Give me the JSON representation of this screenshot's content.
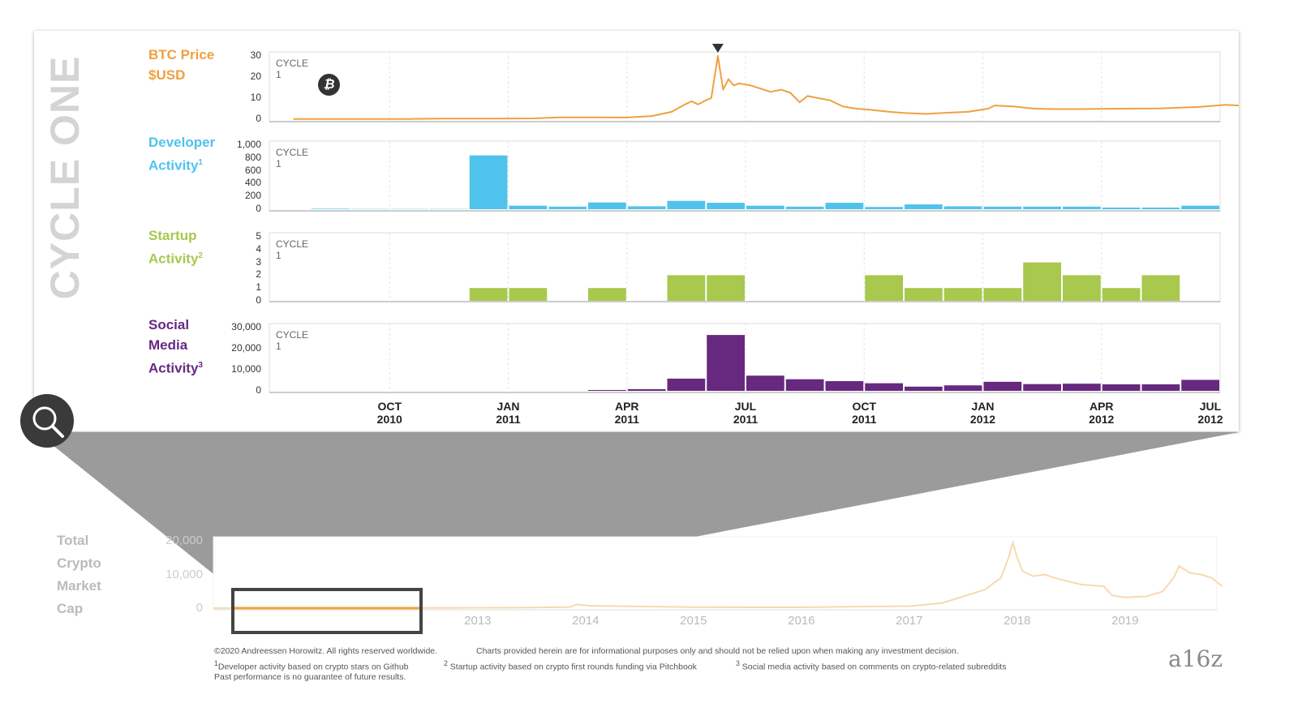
{
  "side_title": "CYCLE ONE",
  "panel_label": "CYCLE 1",
  "colors": {
    "btc": "#F0A040",
    "developer": "#4FC3EC",
    "startup": "#A8C84E",
    "social": "#66297F",
    "grey": "#999999"
  },
  "chart_data": [
    {
      "type": "line",
      "title": "BTC Price $USD",
      "title_lines": [
        "BTC Price",
        "$USD"
      ],
      "yticks": [
        "30",
        "20",
        "10",
        "0"
      ],
      "ylim": [
        0,
        30
      ],
      "icon": "bitcoin-icon",
      "annotation": "peak-marker-triangle",
      "points": [
        [
          "2010-07-18",
          0.07
        ],
        [
          "2010-09-01",
          0.06
        ],
        [
          "2010-10-15",
          0.1
        ],
        [
          "2010-11-10",
          0.3
        ],
        [
          "2010-12-15",
          0.25
        ],
        [
          "2011-01-20",
          0.4
        ],
        [
          "2011-02-10",
          0.9
        ],
        [
          "2011-03-10",
          0.85
        ],
        [
          "2011-04-01",
          0.8
        ],
        [
          "2011-04-20",
          1.5
        ],
        [
          "2011-05-05",
          3.5
        ],
        [
          "2011-05-15",
          7
        ],
        [
          "2011-05-20",
          8.5
        ],
        [
          "2011-05-25",
          7
        ],
        [
          "2011-06-01",
          9
        ],
        [
          "2011-06-05",
          10
        ],
        [
          "2011-06-07",
          18
        ],
        [
          "2011-06-10",
          30
        ],
        [
          "2011-06-12",
          22
        ],
        [
          "2011-06-14",
          14
        ],
        [
          "2011-06-18",
          19
        ],
        [
          "2011-06-22",
          16
        ],
        [
          "2011-06-26",
          17
        ],
        [
          "2011-07-05",
          16
        ],
        [
          "2011-07-20",
          13
        ],
        [
          "2011-07-28",
          14
        ],
        [
          "2011-08-05",
          12.5
        ],
        [
          "2011-08-12",
          8
        ],
        [
          "2011-08-18",
          11
        ],
        [
          "2011-08-26",
          10
        ],
        [
          "2011-09-05",
          9
        ],
        [
          "2011-09-15",
          6
        ],
        [
          "2011-09-25",
          5
        ],
        [
          "2011-10-05",
          4.5
        ],
        [
          "2011-10-20",
          3.5
        ],
        [
          "2011-11-01",
          3
        ],
        [
          "2011-11-18",
          2.5
        ],
        [
          "2011-12-01",
          3
        ],
        [
          "2011-12-20",
          3.5
        ],
        [
          "2012-01-05",
          5
        ],
        [
          "2012-01-10",
          6.5
        ],
        [
          "2012-01-25",
          6
        ],
        [
          "2012-02-10",
          5
        ],
        [
          "2012-02-25",
          4.8
        ],
        [
          "2012-03-15",
          4.8
        ],
        [
          "2012-04-15",
          5
        ],
        [
          "2012-05-15",
          5.1
        ],
        [
          "2012-06-15",
          5.8
        ],
        [
          "2012-07-05",
          6.8
        ],
        [
          "2012-07-15",
          6.5
        ]
      ]
    },
    {
      "type": "bar",
      "title": "Developer Activity",
      "title_lines": [
        "Developer",
        "Activity"
      ],
      "footnote_mark": "1",
      "yticks": [
        "1,000",
        "800",
        "600",
        "400",
        "200",
        "0"
      ],
      "ylim": [
        0,
        1000
      ],
      "categories": [
        "2010-08",
        "2010-09",
        "2010-10",
        "2010-11",
        "2010-12",
        "2011-01",
        "2011-02",
        "2011-03",
        "2011-04",
        "2011-05",
        "2011-06",
        "2011-07",
        "2011-08",
        "2011-09",
        "2011-10",
        "2011-11",
        "2011-12",
        "2012-01",
        "2012-02",
        "2012-03",
        "2012-04",
        "2012-05",
        "2012-06"
      ],
      "values": [
        8,
        4,
        4,
        4,
        840,
        55,
        40,
        105,
        45,
        130,
        100,
        55,
        40,
        100,
        35,
        75,
        45,
        40,
        40,
        40,
        25,
        25,
        55
      ]
    },
    {
      "type": "bar",
      "title": "Startup Activity",
      "title_lines": [
        "Startup",
        "Activity"
      ],
      "footnote_mark": "2",
      "yticks": [
        "5",
        "4",
        "3",
        "2",
        "1",
        "0"
      ],
      "ylim": [
        0,
        5
      ],
      "categories": [
        "2010-12",
        "2011-01",
        "2011-03",
        "2011-05",
        "2011-06",
        "2011-10",
        "2011-11",
        "2011-12",
        "2012-01",
        "2012-02",
        "2012-03",
        "2012-04",
        "2012-05"
      ],
      "values": [
        1,
        1,
        1,
        2,
        2,
        2,
        1,
        1,
        1,
        3,
        2,
        1,
        2
      ]
    },
    {
      "type": "bar",
      "title": "Social Media Activity",
      "title_lines": [
        "Social",
        "Media",
        "Activity"
      ],
      "footnote_mark": "3",
      "yticks": [
        "30,000",
        "20,000",
        "10,000",
        "0"
      ],
      "ylim": [
        0,
        30000
      ],
      "categories": [
        "2011-03",
        "2011-04",
        "2011-05",
        "2011-06",
        "2011-07",
        "2011-08",
        "2011-09",
        "2011-10",
        "2011-11",
        "2011-12",
        "2012-01",
        "2012-02",
        "2012-03",
        "2012-04",
        "2012-05",
        "2012-06"
      ],
      "values": [
        400,
        800,
        5800,
        26500,
        7200,
        5500,
        4600,
        3600,
        2000,
        2600,
        4300,
        3200,
        3400,
        3100,
        3100,
        5200
      ]
    },
    {
      "type": "line",
      "title": "Total Crypto Market Cap",
      "title_lines": [
        "Total",
        "Crypto",
        "Market",
        "Cap"
      ],
      "yticks": [
        "20,000",
        "10,000",
        "0"
      ],
      "ylim": [
        0,
        20000
      ],
      "xticks": [
        "2013",
        "2014",
        "2015",
        "2016",
        "2017",
        "2018",
        "2019"
      ],
      "highlight_range": [
        "2010-07",
        "2012-07"
      ],
      "points": [
        [
          2010.55,
          0
        ],
        [
          2012.5,
          40
        ],
        [
          2013.3,
          150
        ],
        [
          2013.85,
          300
        ],
        [
          2013.92,
          1100
        ],
        [
          2014.05,
          700
        ],
        [
          2014.5,
          500
        ],
        [
          2015,
          300
        ],
        [
          2015.5,
          250
        ],
        [
          2016,
          250
        ],
        [
          2016.5,
          450
        ],
        [
          2017,
          600
        ],
        [
          2017.3,
          1500
        ],
        [
          2017.5,
          3500
        ],
        [
          2017.7,
          5500
        ],
        [
          2017.85,
          9000
        ],
        [
          2017.92,
          15000
        ],
        [
          2017.96,
          19500
        ],
        [
          2018.0,
          15000
        ],
        [
          2018.05,
          11000
        ],
        [
          2018.15,
          9500
        ],
        [
          2018.25,
          10000
        ],
        [
          2018.4,
          8500
        ],
        [
          2018.6,
          7000
        ],
        [
          2018.8,
          6500
        ],
        [
          2018.88,
          3800
        ],
        [
          2019.0,
          3200
        ],
        [
          2019.2,
          3500
        ],
        [
          2019.35,
          5000
        ],
        [
          2019.45,
          9000
        ],
        [
          2019.5,
          12500
        ],
        [
          2019.6,
          10500
        ],
        [
          2019.7,
          10000
        ],
        [
          2019.8,
          9000
        ],
        [
          2019.9,
          6500
        ]
      ]
    }
  ],
  "xaxis_labels": [
    {
      "month": "OCT",
      "year": "2010",
      "date": "2010-10"
    },
    {
      "month": "JAN",
      "year": "2011",
      "date": "2011-01"
    },
    {
      "month": "APR",
      "year": "2011",
      "date": "2011-04"
    },
    {
      "month": "JUL",
      "year": "2011",
      "date": "2011-07"
    },
    {
      "month": "OCT",
      "year": "2011",
      "date": "2011-10"
    },
    {
      "month": "JAN",
      "year": "2012",
      "date": "2012-01"
    },
    {
      "month": "APR",
      "year": "2012",
      "date": "2012-04"
    },
    {
      "month": "JUL",
      "year": "2012",
      "date": "2012-07"
    }
  ],
  "footer": {
    "copyright": "©2020 Andreessen Horowitz. All rights reserved worldwide.",
    "disclaimer": "Charts provided herein are for informational purposes only and should not be relied upon when making any investment decision.",
    "note1": "Developer activity based on crypto stars on Github",
    "note2": "Startup activity based on crypto first rounds funding via Pitchbook",
    "note3": "Social media activity based on comments on crypto-related subreddits",
    "past_performance": "Past performance is no guarantee of future results.",
    "mark1": "1",
    "mark2": "2",
    "mark3": "3"
  },
  "logo": "a16z"
}
